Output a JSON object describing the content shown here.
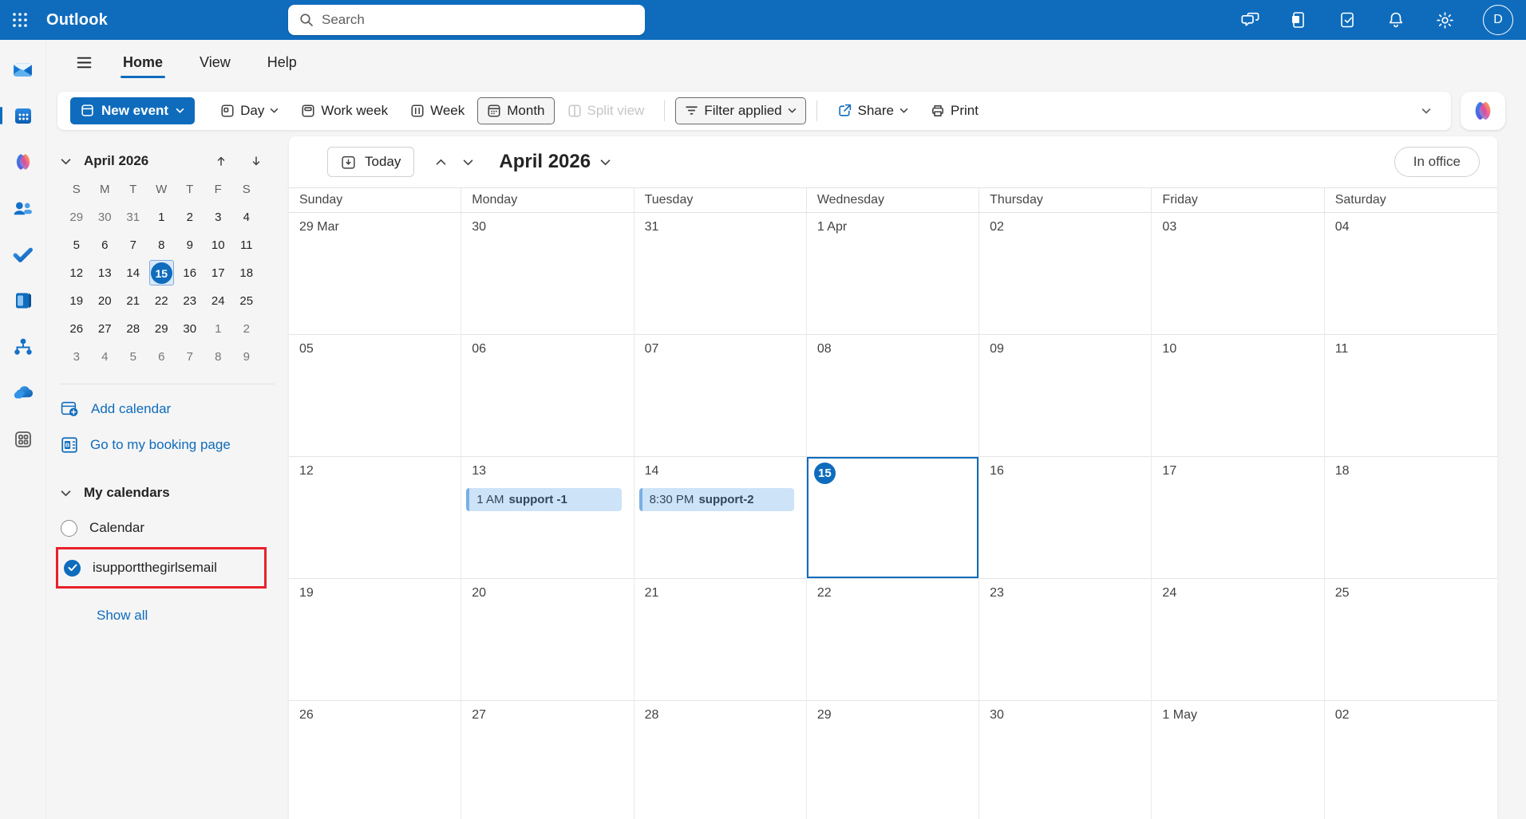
{
  "topbar": {
    "app_title": "Outlook",
    "search_placeholder": "Search",
    "avatar_initial": "D",
    "icons": [
      "chat",
      "onenote-feed",
      "my-day",
      "notifications",
      "settings",
      "account"
    ]
  },
  "rail": {
    "items": [
      "mail",
      "calendar",
      "copilot",
      "people",
      "todo",
      "notebook",
      "org-explorer",
      "onedrive",
      "more-apps"
    ],
    "selected": "calendar"
  },
  "menubar": {
    "tabs": [
      {
        "label": "Home",
        "active": true
      },
      {
        "label": "View",
        "active": false
      },
      {
        "label": "Help",
        "active": false
      }
    ]
  },
  "ribbon": {
    "new_event_label": "New event",
    "views": [
      {
        "label": "Day",
        "chevron": true
      },
      {
        "label": "Work week"
      },
      {
        "label": "Week"
      },
      {
        "label": "Month",
        "selected": true
      },
      {
        "label": "Split view",
        "disabled": true
      }
    ],
    "filter_label": "Filter applied",
    "share_label": "Share",
    "print_label": "Print"
  },
  "sidebar": {
    "mini_calendar": {
      "title": "April 2026",
      "dow": [
        "S",
        "M",
        "T",
        "W",
        "T",
        "F",
        "S"
      ],
      "weeks": [
        [
          {
            "d": "29",
            "out": true
          },
          {
            "d": "30",
            "out": true
          },
          {
            "d": "31",
            "out": true
          },
          {
            "d": "1"
          },
          {
            "d": "2"
          },
          {
            "d": "3"
          },
          {
            "d": "4"
          }
        ],
        [
          {
            "d": "5"
          },
          {
            "d": "6"
          },
          {
            "d": "7"
          },
          {
            "d": "8"
          },
          {
            "d": "9"
          },
          {
            "d": "10"
          },
          {
            "d": "11"
          }
        ],
        [
          {
            "d": "12"
          },
          {
            "d": "13"
          },
          {
            "d": "14"
          },
          {
            "d": "15",
            "sel": true
          },
          {
            "d": "16"
          },
          {
            "d": "17"
          },
          {
            "d": "18"
          }
        ],
        [
          {
            "d": "19"
          },
          {
            "d": "20"
          },
          {
            "d": "21"
          },
          {
            "d": "22"
          },
          {
            "d": "23"
          },
          {
            "d": "24"
          },
          {
            "d": "25"
          }
        ],
        [
          {
            "d": "26"
          },
          {
            "d": "27"
          },
          {
            "d": "28"
          },
          {
            "d": "29"
          },
          {
            "d": "30"
          },
          {
            "d": "1",
            "out": true
          },
          {
            "d": "2",
            "out": true
          }
        ],
        [
          {
            "d": "3",
            "out": true
          },
          {
            "d": "4",
            "out": true
          },
          {
            "d": "5",
            "out": true
          },
          {
            "d": "6",
            "out": true
          },
          {
            "d": "7",
            "out": true
          },
          {
            "d": "8",
            "out": true
          },
          {
            "d": "9",
            "out": true
          }
        ]
      ]
    },
    "add_calendar_label": "Add calendar",
    "booking_label": "Go to my booking page",
    "my_calendars_label": "My calendars",
    "calendars": [
      {
        "label": "Calendar",
        "checked": false,
        "highlighted": false
      },
      {
        "label": "isupportthegirlsemail",
        "checked": true,
        "highlighted": true
      }
    ],
    "show_all_label": "Show all"
  },
  "main": {
    "today_label": "Today",
    "title": "April 2026",
    "status_label": "In office",
    "grid": {
      "day_headers": [
        "Sunday",
        "Monday",
        "Tuesday",
        "Wednesday",
        "Thursday",
        "Friday",
        "Saturday"
      ],
      "rows": [
        [
          {
            "label": "29 Mar"
          },
          {
            "label": "30"
          },
          {
            "label": "31"
          },
          {
            "label": "1 Apr"
          },
          {
            "label": "02"
          },
          {
            "label": "03"
          },
          {
            "label": "04"
          }
        ],
        [
          {
            "label": "05"
          },
          {
            "label": "06"
          },
          {
            "label": "07"
          },
          {
            "label": "08"
          },
          {
            "label": "09"
          },
          {
            "label": "10"
          },
          {
            "label": "11"
          }
        ],
        [
          {
            "label": "12"
          },
          {
            "label": "13",
            "event": {
              "time": "1 AM",
              "title": "support -1"
            }
          },
          {
            "label": "14",
            "event": {
              "time": "8:30 PM",
              "title": "support-2"
            }
          },
          {
            "label": "15",
            "selected": true
          },
          {
            "label": "16"
          },
          {
            "label": "17"
          },
          {
            "label": "18"
          }
        ],
        [
          {
            "label": "19"
          },
          {
            "label": "20"
          },
          {
            "label": "21"
          },
          {
            "label": "22"
          },
          {
            "label": "23"
          },
          {
            "label": "24"
          },
          {
            "label": "25"
          }
        ],
        [
          {
            "label": "26"
          },
          {
            "label": "27"
          },
          {
            "label": "28"
          },
          {
            "label": "29"
          },
          {
            "label": "30"
          },
          {
            "label": "1 May"
          },
          {
            "label": "02"
          }
        ]
      ]
    }
  },
  "colors": {
    "brand": "#0f6cbd",
    "highlight_red": "#e8212b",
    "event_bg": "#cde3f7",
    "event_stripe": "#79b0e4"
  }
}
